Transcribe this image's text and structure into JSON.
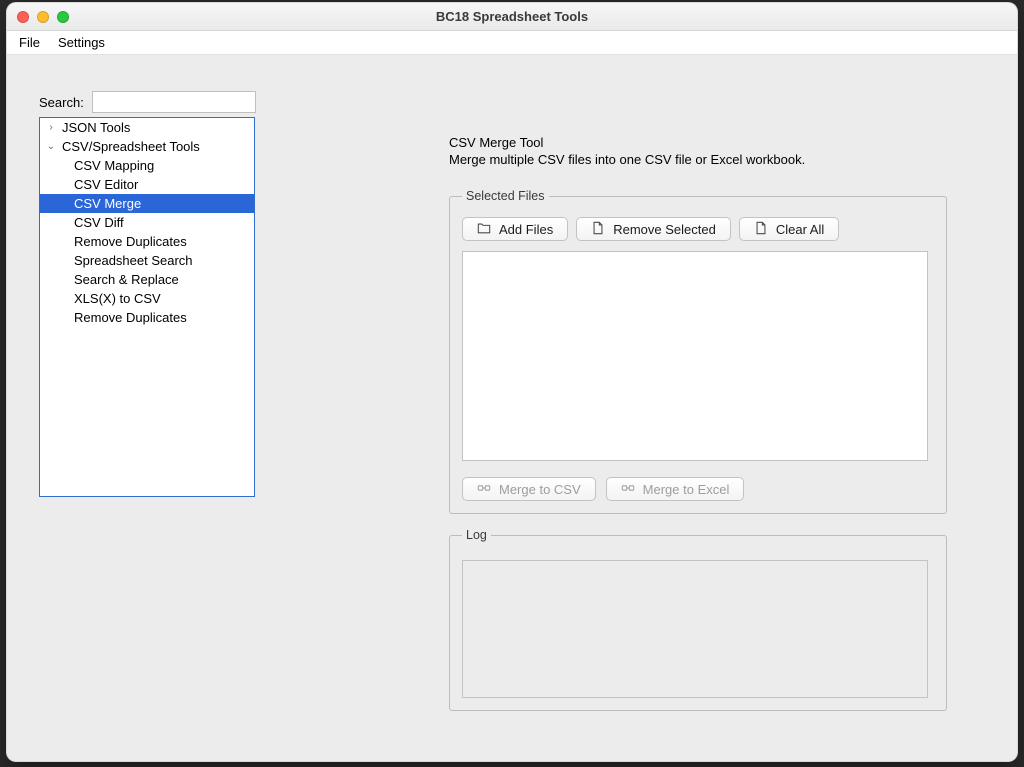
{
  "window_title": "BC18 Spreadsheet Tools",
  "menubar": {
    "file": "File",
    "settings": "Settings"
  },
  "sidebar": {
    "search_label": "Search:",
    "search_value": "",
    "items": [
      {
        "label": "JSON Tools",
        "depth": 1,
        "arrow": "closed"
      },
      {
        "label": "CSV/Spreadsheet Tools",
        "depth": 1,
        "arrow": "open"
      },
      {
        "label": "CSV Mapping",
        "depth": 2
      },
      {
        "label": "CSV Editor",
        "depth": 2
      },
      {
        "label": "CSV Merge",
        "depth": 2,
        "selected": true
      },
      {
        "label": "CSV Diff",
        "depth": 2
      },
      {
        "label": "Remove Duplicates",
        "depth": 2
      },
      {
        "label": "Spreadsheet Search",
        "depth": 2
      },
      {
        "label": "Search & Replace",
        "depth": 2
      },
      {
        "label": "XLS(X) to CSV",
        "depth": 2
      },
      {
        "label": "Remove Duplicates",
        "depth": 2
      }
    ]
  },
  "tool": {
    "title": "CSV Merge Tool",
    "description": "Merge multiple CSV files into one CSV file or Excel workbook."
  },
  "selected_files": {
    "legend": "Selected Files",
    "add_files": "Add Files",
    "remove_selected": "Remove Selected",
    "clear_all": "Clear All",
    "merge_to_csv": "Merge to CSV",
    "merge_to_excel": "Merge to Excel"
  },
  "log": {
    "legend": "Log"
  }
}
